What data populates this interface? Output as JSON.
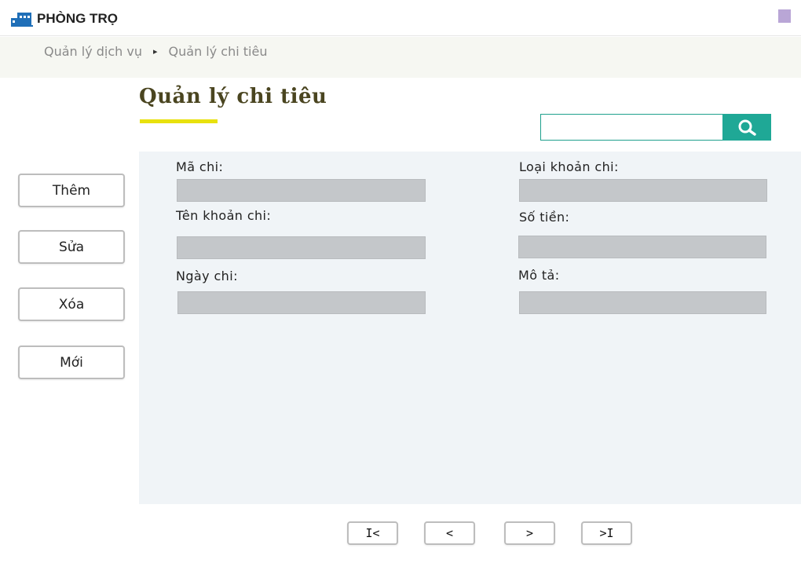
{
  "header": {
    "brand": "PHÒNG TRỌ",
    "brand_color": "#1f6fb8",
    "user_menu_color": "#b9a6d6"
  },
  "breadcrumb": {
    "items": [
      "Quản lý dịch vụ",
      "Quản lý chi tiêu"
    ],
    "separator": "▸"
  },
  "page": {
    "title": "Quản lý chi tiêu",
    "accent_color": "#e8e10e"
  },
  "search": {
    "value": "",
    "placeholder": "",
    "button_icon": "search-icon",
    "button_color": "#1fa896"
  },
  "actions": {
    "add": "Thêm",
    "edit": "Sửa",
    "delete": "Xóa",
    "new": "Mới"
  },
  "form": {
    "fields": [
      {
        "label": "Mã chi:",
        "value": ""
      },
      {
        "label": "Loại khoản chi:",
        "value": ""
      },
      {
        "label": "Tên khoản chi:",
        "value": ""
      },
      {
        "label": "Số tiền:",
        "value": ""
      },
      {
        "label": "Ngày chi:",
        "value": ""
      },
      {
        "label": "Mô tả:",
        "value": ""
      }
    ]
  },
  "pagination": {
    "first": "I<",
    "prev": "<",
    "next": ">",
    "last": ">I"
  }
}
